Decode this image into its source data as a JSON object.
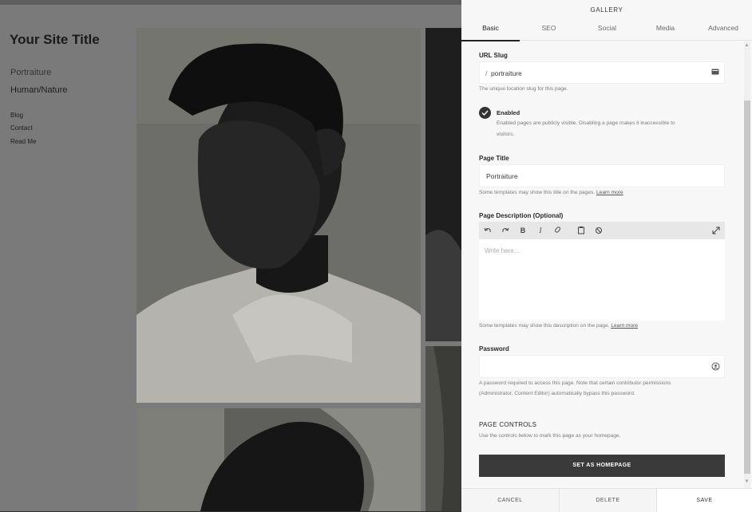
{
  "site": {
    "title": "Your Site Title",
    "nav": {
      "items": [
        "Portraiture",
        "Human/Nature"
      ],
      "secondary": [
        "Blog",
        "Contact",
        "Read Me"
      ]
    }
  },
  "panel": {
    "title": "GALLERY",
    "tabs": [
      "Basic",
      "SEO",
      "Social",
      "Media",
      "Advanced"
    ],
    "active_tab": "Basic",
    "url_slug": {
      "label": "URL Slug",
      "prefix": "/",
      "value": "portraiture",
      "help": "The unique location slug for this page."
    },
    "enabled": {
      "label": "Enabled",
      "checked": true,
      "help_line1": "Enabled pages are publicly visible. Disabling a page makes it inaccessible to",
      "help_line2": "visitors."
    },
    "page_title": {
      "label": "Page Title",
      "value": "Portraiture",
      "help": "Some templates may show this title on the pages.",
      "learn_more": "Learn more"
    },
    "page_description": {
      "label": "Page Description (Optional)",
      "placeholder": "Write here...",
      "help": "Some templates may show this description on the page.",
      "learn_more": "Learn more",
      "toolbar": [
        "undo-icon",
        "redo-icon",
        "bold-icon",
        "italic-icon",
        "link-icon",
        "clipboard-icon",
        "clear-format-icon",
        "expand-icon"
      ]
    },
    "password": {
      "label": "Password",
      "value": "",
      "help_line1": "A password required to access this page. Note that certain contributor permissions",
      "help_line2": "(Administrator, Content Editor) automatically bypass this password."
    },
    "page_controls": {
      "heading": "PAGE CONTROLS",
      "help": "Use the controls below to mark this page as your homepage.",
      "button": "SET AS HOMEPAGE"
    },
    "footer": {
      "cancel": "CANCEL",
      "delete": "DELETE",
      "save": "SAVE"
    }
  },
  "colors": {
    "panel_bg": "#f7f7f7",
    "primary_button": "#3a3a3a",
    "overlay": "#7a7a7a"
  }
}
